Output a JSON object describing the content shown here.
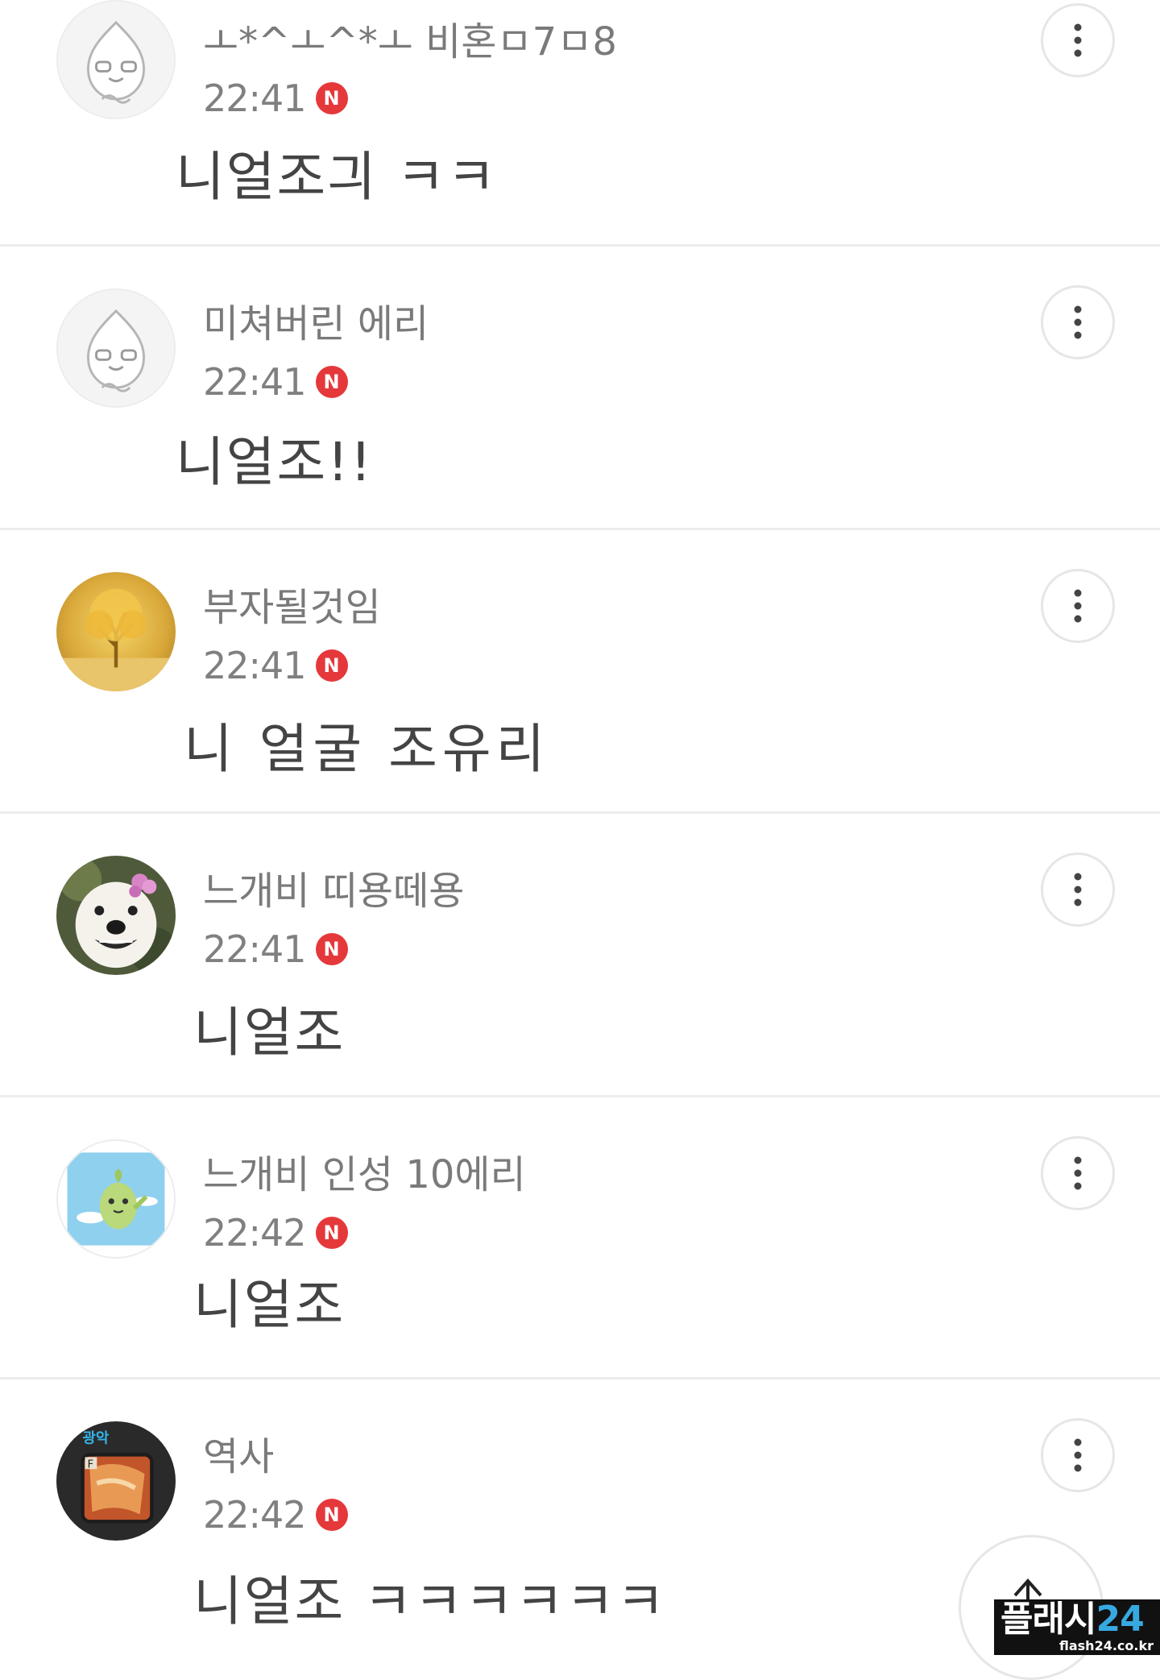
{
  "comments": [
    {
      "nickname": "ㅗ*^ㅗ^*ㅗ 비혼ㅁ7ㅁ8",
      "time": "22:41",
      "new_badge": "N",
      "content": "니얼조긔 ㅋㅋ",
      "avatar_icon": "peach-face-avatar-icon"
    },
    {
      "nickname": "미쳐버린 에리",
      "time": "22:41",
      "new_badge": "N",
      "content": "니얼조!!",
      "avatar_icon": "peach-face-avatar-icon"
    },
    {
      "nickname": "부자될것임",
      "time": "22:41",
      "new_badge": "N",
      "content": "니 얼굴 조유리",
      "avatar_icon": "golden-tree-avatar-icon"
    },
    {
      "nickname": "느개비 띠용떼용",
      "time": "22:41",
      "new_badge": "N",
      "content": "니얼조",
      "avatar_icon": "smiling-dog-avatar-icon"
    },
    {
      "nickname": "느개비 인성 10에리",
      "time": "22:42",
      "new_badge": "N",
      "content": "니얼조",
      "avatar_icon": "green-bird-avatar-icon"
    },
    {
      "nickname": "역사",
      "time": "22:42",
      "new_badge": "N",
      "content": "니얼조 ㅋㅋㅋㅋㅋㅋ",
      "avatar_icon": "game-art-avatar-icon",
      "avatar_label": "광악"
    }
  ],
  "watermark": {
    "main_prefix": "플래시",
    "main_suffix": "24",
    "sub": "flash24.co.kr"
  },
  "colors": {
    "new_badge": "#e5383b",
    "divider": "#ececec",
    "watermark_accent": "#36a9e1"
  }
}
